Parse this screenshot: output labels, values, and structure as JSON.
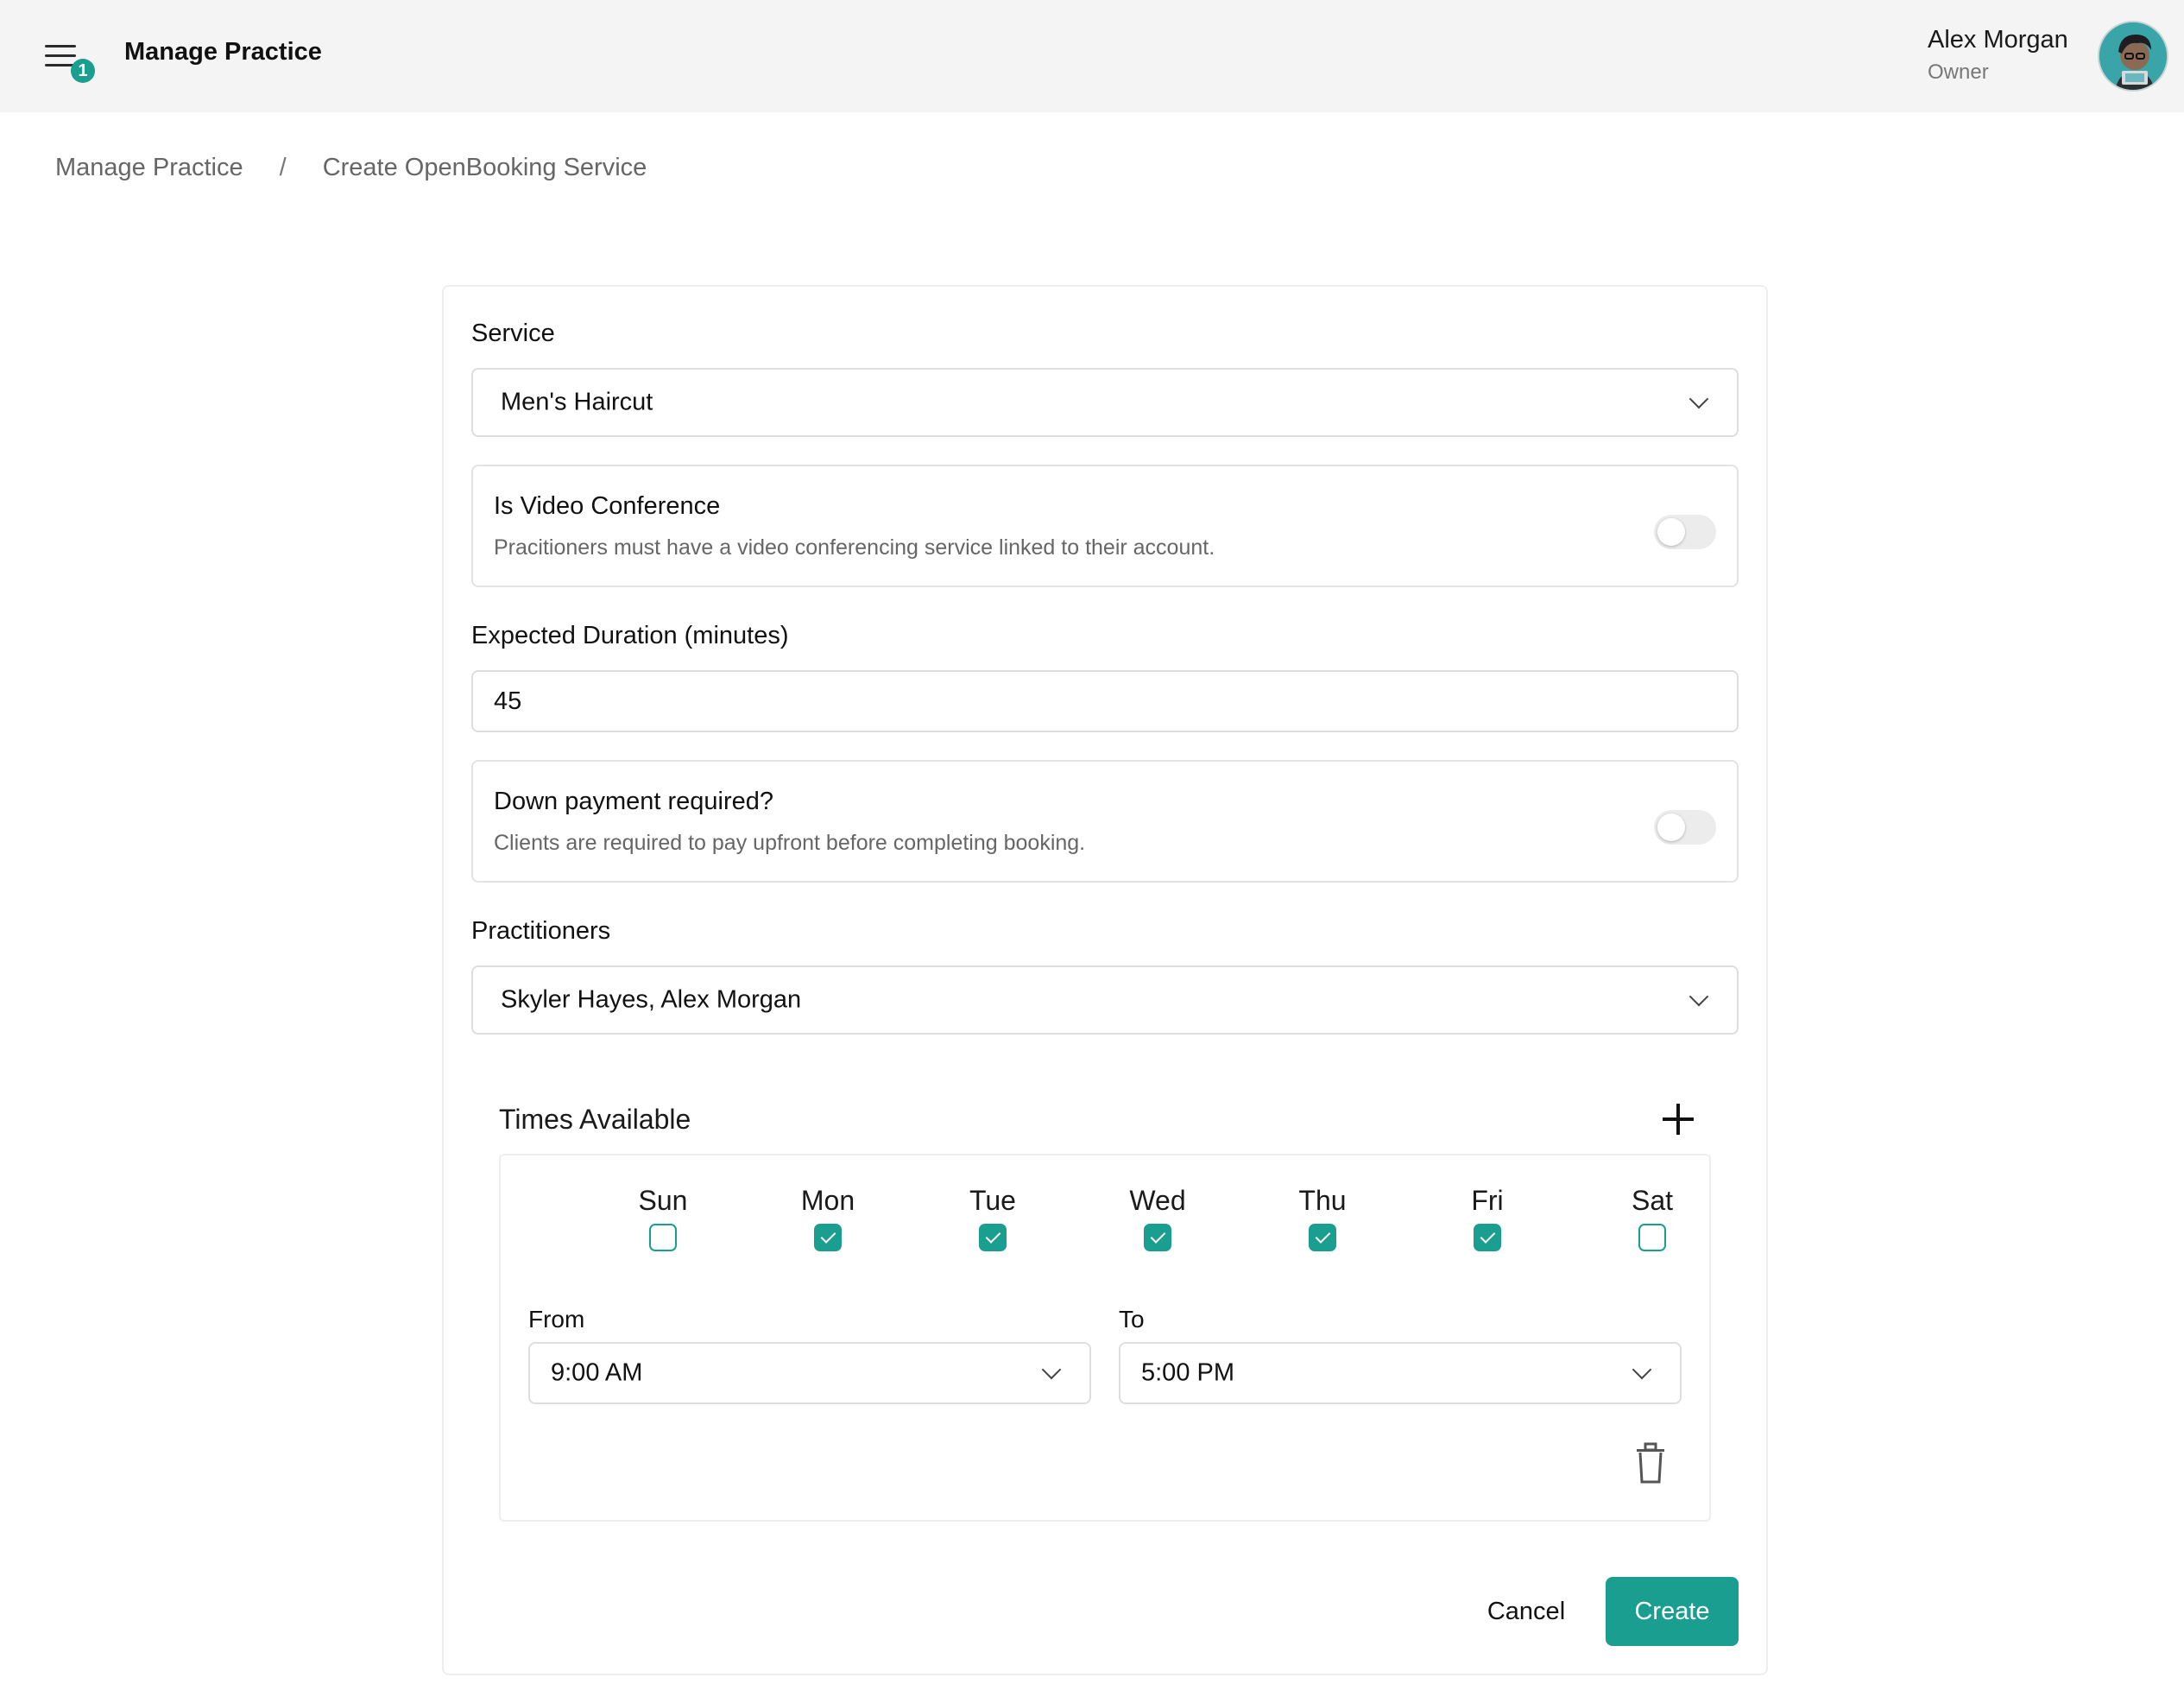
{
  "header": {
    "notification_count": "1",
    "app_title": "Manage Practice",
    "user_name": "Alex Morgan",
    "user_role": "Owner"
  },
  "breadcrumb": {
    "items": [
      "Manage Practice",
      "Create OpenBooking Service"
    ],
    "separator": "/"
  },
  "form": {
    "service": {
      "label": "Service",
      "value": "Men's Haircut"
    },
    "video_conference": {
      "title": "Is Video Conference",
      "description": "Pracitioners must have a video conferencing service linked to their account.",
      "enabled": false
    },
    "duration": {
      "label": "Expected Duration (minutes)",
      "value": "45"
    },
    "down_payment": {
      "title": "Down payment required?",
      "description": "Clients are required to pay upfront before completing booking.",
      "enabled": false
    },
    "practitioners": {
      "label": "Practitioners",
      "value": "Skyler Hayes, Alex Morgan"
    },
    "times": {
      "title": "Times Available",
      "days": [
        {
          "label": "Sun",
          "checked": false
        },
        {
          "label": "Mon",
          "checked": true
        },
        {
          "label": "Tue",
          "checked": true
        },
        {
          "label": "Wed",
          "checked": true
        },
        {
          "label": "Thu",
          "checked": true
        },
        {
          "label": "Fri",
          "checked": true
        },
        {
          "label": "Sat",
          "checked": false
        }
      ],
      "from_label": "From",
      "from_value": "9:00 AM",
      "to_label": "To",
      "to_value": "5:00 PM"
    },
    "cancel_label": "Cancel",
    "create_label": "Create"
  },
  "colors": {
    "accent": "#1a9e8f",
    "header_bg": "#f4f4f4"
  }
}
